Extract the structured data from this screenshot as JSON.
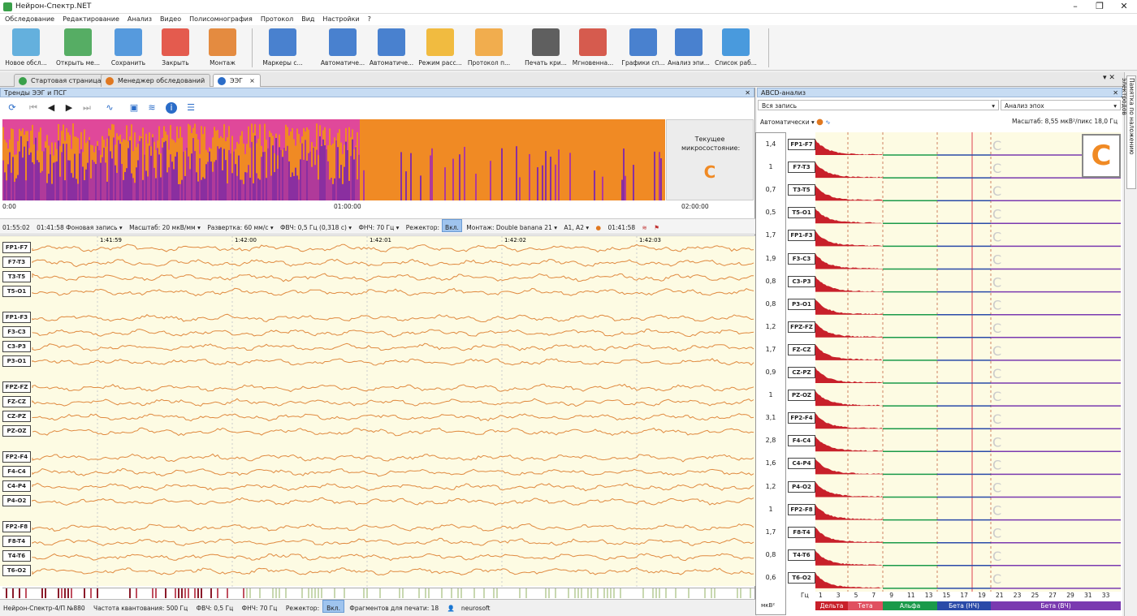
{
  "app": {
    "title": "Нейрон-Спектр.NET"
  },
  "menu": [
    "Обследование",
    "Редактирование",
    "Анализ",
    "Видео",
    "Полисомнография",
    "Протокол",
    "Вид",
    "Настройки",
    "?"
  ],
  "toolbar": [
    {
      "label": "Новое обсл...",
      "icon": "new-exam-icon",
      "color": "#4aa3d8"
    },
    {
      "label": "Открыть ме...",
      "icon": "open-icon",
      "color": "#3aa04a"
    },
    {
      "label": "Сохранить",
      "icon": "save-icon",
      "color": "#3a8ad8"
    },
    {
      "label": "Закрыть",
      "icon": "close-exam-icon",
      "color": "#e04030"
    },
    {
      "label": "Монтаж",
      "icon": "montage-icon",
      "color": "#e07820"
    },
    {
      "label": "Маркеры с...",
      "icon": "markers-icon",
      "color": "#2a6cc8"
    },
    {
      "label": "Автоматиче...",
      "icon": "auto-analysis-icon",
      "color": "#2a6cc8"
    },
    {
      "label": "Автоматиче...",
      "icon": "auto-detect-icon",
      "color": "#2a6cc8"
    },
    {
      "label": "Режим расс...",
      "icon": "review-mode-icon",
      "color": "#f0b020"
    },
    {
      "label": "Протокол п...",
      "icon": "protocol-icon",
      "color": "#f0a030"
    },
    {
      "label": "Печать кри...",
      "icon": "print-icon",
      "color": "#444444"
    },
    {
      "label": "Мгновенна...",
      "icon": "instant-map-icon",
      "color": "#d04030"
    },
    {
      "label": "Графики сп...",
      "icon": "spectrum-graphs-icon",
      "color": "#2a6cc8"
    },
    {
      "label": "Анализ эпи...",
      "icon": "epoch-analysis-icon",
      "color": "#2a6cc8"
    },
    {
      "label": "Список раб...",
      "icon": "worklist-icon",
      "color": "#2a8ad8"
    }
  ],
  "tabs": [
    {
      "label": "Стартовая страница"
    },
    {
      "label": "Менеджер обследований"
    },
    {
      "label": "ЭЭГ"
    }
  ],
  "left": {
    "panel_title": "Тренды ЭЭГ и ПСГ",
    "current_state_label": "Текущее микросостояние:",
    "current_state_value": "C",
    "trend_times": [
      "0:00",
      "01:00:00",
      "02:00:00"
    ],
    "eegbar": {
      "time": "01:55:02",
      "time2": "01:41:58",
      "record": "Фоновая запись",
      "scale": "Масштаб: 20 мкВ/мм",
      "sweep": "Развертка: 60 мм/с",
      "hpf": "ФВЧ: 0,5 Гц (0,318 с)",
      "lpf": "ФНЧ: 70 Гц",
      "notch": "Режектор:",
      "notch_state": "Вкл.",
      "montage": "Монтаж: Double banana 21",
      "ref": "A1, A2",
      "cursor_time": "01:41:58"
    },
    "time_ticks": [
      "1:41:59",
      "1:42:00",
      "1:42:01",
      "1:42:02",
      "1:42:03"
    ],
    "channels": [
      "FP1-F7",
      "F7-T3",
      "T3-T5",
      "T5-O1",
      "FP1-F3",
      "F3-C3",
      "C3-P3",
      "P3-O1",
      "FPZ-FZ",
      "FZ-CZ",
      "CZ-PZ",
      "PZ-OZ",
      "FP2-F4",
      "F4-C4",
      "C4-P4",
      "P4-O2",
      "FP2-F8",
      "F8-T4",
      "T4-T6",
      "T6-O2"
    ],
    "status": {
      "device": "Нейрон-Спектр-4/П №880",
      "rate": "Частота квантования: 500 Гц",
      "hpf": "ФВЧ: 0,5 Гц",
      "lpf": "ФНЧ: 70 Гц",
      "notch": "Режектор:",
      "notch_state": "Вкл.",
      "fragments": "Фрагментов для печати: 18",
      "user": "neurosoft"
    }
  },
  "right": {
    "panel_title": "ABCD-анализ",
    "range": "Вся запись",
    "mode": "Анализ эпох",
    "auto": "Автоматически",
    "scale": "Масштаб: 8,55 мкВ²/пикс 18,0 Гц",
    "big_state": "C",
    "amp_values": [
      "1,4",
      "1",
      "0,7",
      "0,5",
      "1,7",
      "1,9",
      "0,8",
      "0,8",
      "1,2",
      "1,7",
      "0,9",
      "1",
      "3,1",
      "2,8",
      "1,6",
      "1,2",
      "1",
      "1,7",
      "0,8",
      "0,6"
    ],
    "amp_unit": "мкВ²",
    "freq_label": "Гц",
    "freq_ticks": [
      "1",
      "3",
      "5",
      "7",
      "9",
      "11",
      "13",
      "15",
      "17",
      "19",
      "21",
      "23",
      "25",
      "27",
      "29",
      "31",
      "33"
    ],
    "bands": [
      {
        "label": "Дельта",
        "color": "#c8202a"
      },
      {
        "label": "Тета",
        "color": "#e05060"
      },
      {
        "label": "Альфа",
        "color": "#1a9a4a"
      },
      {
        "label": "Бета (НЧ)",
        "color": "#2a4aa8"
      },
      {
        "label": "Бета (ВЧ)",
        "color": "#7a3ab0"
      }
    ]
  },
  "sidebar": {
    "label": "Памятка по наложению электродов"
  }
}
